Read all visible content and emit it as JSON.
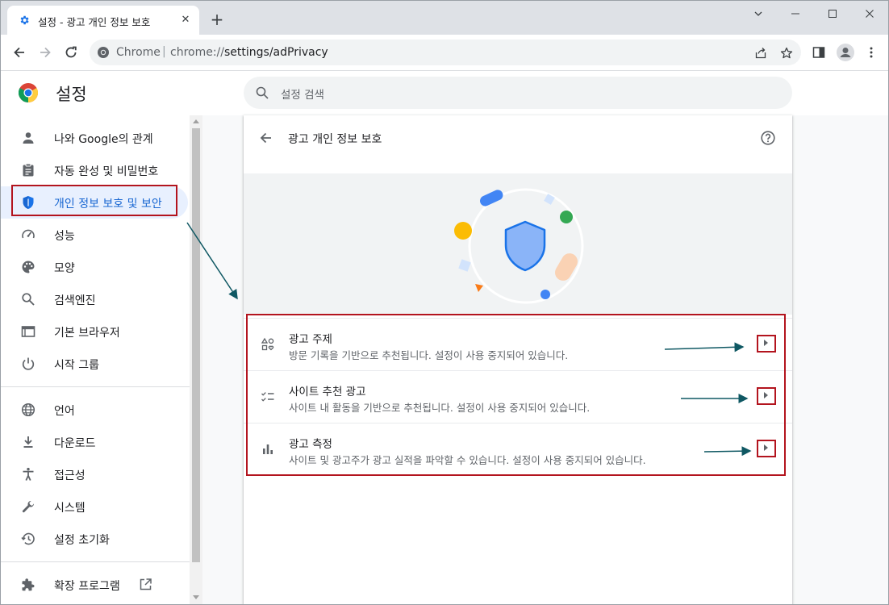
{
  "browser": {
    "tab_title": "설정 - 광고 개인 정보 보호",
    "tab_close": "✕",
    "new_tab": "+",
    "omnibox_label": "Chrome",
    "url_host": "chrome://",
    "url_path": "settings/adPrivacy"
  },
  "settings": {
    "title": "설정",
    "search_placeholder": "설정 검색"
  },
  "sidebar": {
    "items": [
      {
        "label": "나와 Google의 관계"
      },
      {
        "label": "자동 완성 및 비밀번호"
      },
      {
        "label": "개인 정보 보호 및 보안"
      },
      {
        "label": "성능"
      },
      {
        "label": "모양"
      },
      {
        "label": "검색엔진"
      },
      {
        "label": "기본 브라우저"
      },
      {
        "label": "시작 그룹"
      },
      {
        "label": "언어"
      },
      {
        "label": "다운로드"
      },
      {
        "label": "접근성"
      },
      {
        "label": "시스템"
      },
      {
        "label": "설정 초기화"
      },
      {
        "label": "확장 프로그램"
      }
    ]
  },
  "page": {
    "title": "광고 개인 정보 보호",
    "rows": [
      {
        "title": "광고 주제",
        "description": "방문 기록을 기반으로 추천됩니다. 설정이 사용 중지되어 있습니다."
      },
      {
        "title": "사이트 추천 광고",
        "description": "사이트 내 활동을 기반으로 추천됩니다. 설정이 사용 중지되어 있습니다."
      },
      {
        "title": "광고 측정",
        "description": "사이트 및 광고주가 광고 실적을 파악할 수 있습니다. 설정이 사용 중지되어 있습니다."
      }
    ]
  },
  "colors": {
    "accent": "#1a73e8",
    "annotation_red": "#b3141e",
    "annotation_arrow": "#0f5863"
  }
}
